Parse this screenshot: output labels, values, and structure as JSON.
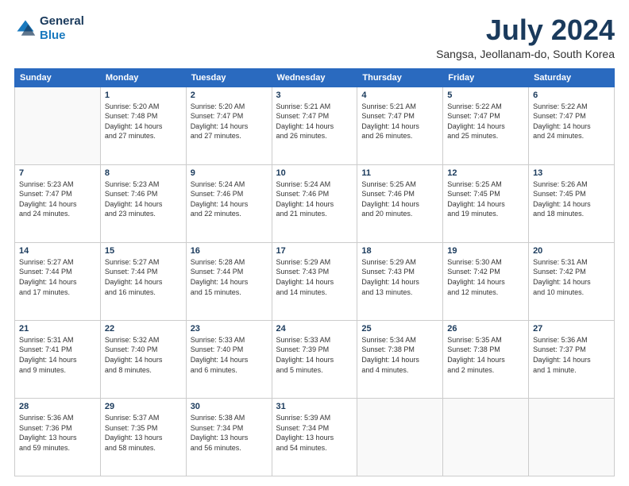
{
  "header": {
    "logo_general": "General",
    "logo_blue": "Blue",
    "month": "July 2024",
    "location": "Sangsa, Jeollanam-do, South Korea"
  },
  "days_of_week": [
    "Sunday",
    "Monday",
    "Tuesday",
    "Wednesday",
    "Thursday",
    "Friday",
    "Saturday"
  ],
  "weeks": [
    [
      {
        "day": "",
        "info": ""
      },
      {
        "day": "1",
        "info": "Sunrise: 5:20 AM\nSunset: 7:48 PM\nDaylight: 14 hours\nand 27 minutes."
      },
      {
        "day": "2",
        "info": "Sunrise: 5:20 AM\nSunset: 7:47 PM\nDaylight: 14 hours\nand 27 minutes."
      },
      {
        "day": "3",
        "info": "Sunrise: 5:21 AM\nSunset: 7:47 PM\nDaylight: 14 hours\nand 26 minutes."
      },
      {
        "day": "4",
        "info": "Sunrise: 5:21 AM\nSunset: 7:47 PM\nDaylight: 14 hours\nand 26 minutes."
      },
      {
        "day": "5",
        "info": "Sunrise: 5:22 AM\nSunset: 7:47 PM\nDaylight: 14 hours\nand 25 minutes."
      },
      {
        "day": "6",
        "info": "Sunrise: 5:22 AM\nSunset: 7:47 PM\nDaylight: 14 hours\nand 24 minutes."
      }
    ],
    [
      {
        "day": "7",
        "info": "Sunrise: 5:23 AM\nSunset: 7:47 PM\nDaylight: 14 hours\nand 24 minutes."
      },
      {
        "day": "8",
        "info": "Sunrise: 5:23 AM\nSunset: 7:46 PM\nDaylight: 14 hours\nand 23 minutes."
      },
      {
        "day": "9",
        "info": "Sunrise: 5:24 AM\nSunset: 7:46 PM\nDaylight: 14 hours\nand 22 minutes."
      },
      {
        "day": "10",
        "info": "Sunrise: 5:24 AM\nSunset: 7:46 PM\nDaylight: 14 hours\nand 21 minutes."
      },
      {
        "day": "11",
        "info": "Sunrise: 5:25 AM\nSunset: 7:46 PM\nDaylight: 14 hours\nand 20 minutes."
      },
      {
        "day": "12",
        "info": "Sunrise: 5:25 AM\nSunset: 7:45 PM\nDaylight: 14 hours\nand 19 minutes."
      },
      {
        "day": "13",
        "info": "Sunrise: 5:26 AM\nSunset: 7:45 PM\nDaylight: 14 hours\nand 18 minutes."
      }
    ],
    [
      {
        "day": "14",
        "info": "Sunrise: 5:27 AM\nSunset: 7:44 PM\nDaylight: 14 hours\nand 17 minutes."
      },
      {
        "day": "15",
        "info": "Sunrise: 5:27 AM\nSunset: 7:44 PM\nDaylight: 14 hours\nand 16 minutes."
      },
      {
        "day": "16",
        "info": "Sunrise: 5:28 AM\nSunset: 7:44 PM\nDaylight: 14 hours\nand 15 minutes."
      },
      {
        "day": "17",
        "info": "Sunrise: 5:29 AM\nSunset: 7:43 PM\nDaylight: 14 hours\nand 14 minutes."
      },
      {
        "day": "18",
        "info": "Sunrise: 5:29 AM\nSunset: 7:43 PM\nDaylight: 14 hours\nand 13 minutes."
      },
      {
        "day": "19",
        "info": "Sunrise: 5:30 AM\nSunset: 7:42 PM\nDaylight: 14 hours\nand 12 minutes."
      },
      {
        "day": "20",
        "info": "Sunrise: 5:31 AM\nSunset: 7:42 PM\nDaylight: 14 hours\nand 10 minutes."
      }
    ],
    [
      {
        "day": "21",
        "info": "Sunrise: 5:31 AM\nSunset: 7:41 PM\nDaylight: 14 hours\nand 9 minutes."
      },
      {
        "day": "22",
        "info": "Sunrise: 5:32 AM\nSunset: 7:40 PM\nDaylight: 14 hours\nand 8 minutes."
      },
      {
        "day": "23",
        "info": "Sunrise: 5:33 AM\nSunset: 7:40 PM\nDaylight: 14 hours\nand 6 minutes."
      },
      {
        "day": "24",
        "info": "Sunrise: 5:33 AM\nSunset: 7:39 PM\nDaylight: 14 hours\nand 5 minutes."
      },
      {
        "day": "25",
        "info": "Sunrise: 5:34 AM\nSunset: 7:38 PM\nDaylight: 14 hours\nand 4 minutes."
      },
      {
        "day": "26",
        "info": "Sunrise: 5:35 AM\nSunset: 7:38 PM\nDaylight: 14 hours\nand 2 minutes."
      },
      {
        "day": "27",
        "info": "Sunrise: 5:36 AM\nSunset: 7:37 PM\nDaylight: 14 hours\nand 1 minute."
      }
    ],
    [
      {
        "day": "28",
        "info": "Sunrise: 5:36 AM\nSunset: 7:36 PM\nDaylight: 13 hours\nand 59 minutes."
      },
      {
        "day": "29",
        "info": "Sunrise: 5:37 AM\nSunset: 7:35 PM\nDaylight: 13 hours\nand 58 minutes."
      },
      {
        "day": "30",
        "info": "Sunrise: 5:38 AM\nSunset: 7:34 PM\nDaylight: 13 hours\nand 56 minutes."
      },
      {
        "day": "31",
        "info": "Sunrise: 5:39 AM\nSunset: 7:34 PM\nDaylight: 13 hours\nand 54 minutes."
      },
      {
        "day": "",
        "info": ""
      },
      {
        "day": "",
        "info": ""
      },
      {
        "day": "",
        "info": ""
      }
    ]
  ]
}
